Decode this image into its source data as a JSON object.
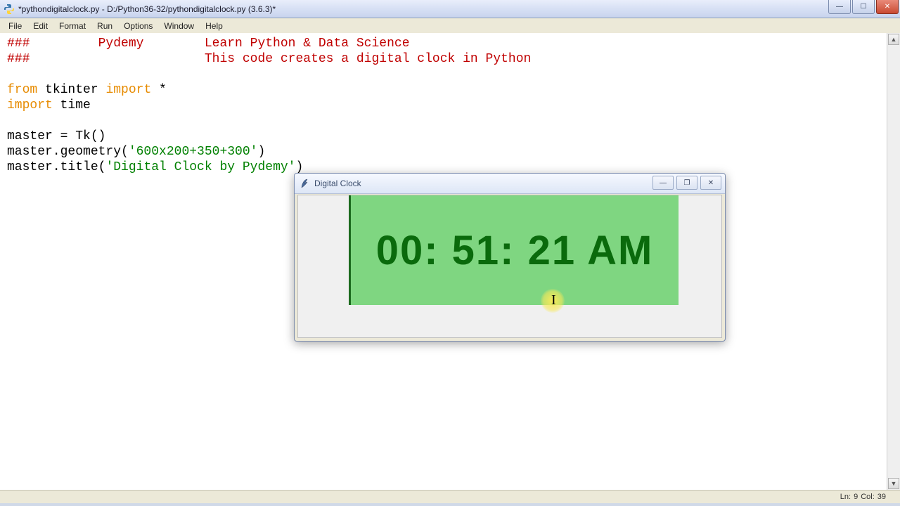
{
  "window": {
    "title": "*pythondigitalclock.py - D:/Python36-32/pythondigitalclock.py (3.6.3)*"
  },
  "menus": {
    "file": "File",
    "edit": "Edit",
    "format": "Format",
    "run": "Run",
    "options": "Options",
    "window": "Window",
    "help": "Help"
  },
  "code": {
    "comment1": "###         Pydemy        Learn Python & Data Science",
    "comment2": "###                       This code creates a digital clock in Python",
    "kw_from": "from",
    "mod_tkinter": " tkinter ",
    "kw_import": "import",
    "star": " *",
    "mod_time": " time",
    "l_master_tk": "master = Tk()",
    "l_geom_a": "master.geometry(",
    "l_geom_str": "'600x200+350+300'",
    "l_geom_b": ")",
    "l_title_a": "master.title(",
    "l_title_str": "'Digital Clock by Pydemy'",
    "l_title_b": ")"
  },
  "status": {
    "ln_label": "Ln: ",
    "ln_val": "9",
    "col_label": "Col: ",
    "col_val": "39"
  },
  "clock": {
    "title": "Digital Clock",
    "time": "00: 51: 21 AM"
  },
  "glyphs": {
    "min": "—",
    "max": "☐",
    "close": "✕",
    "max2": "❐",
    "up": "▲",
    "down": "▼"
  }
}
